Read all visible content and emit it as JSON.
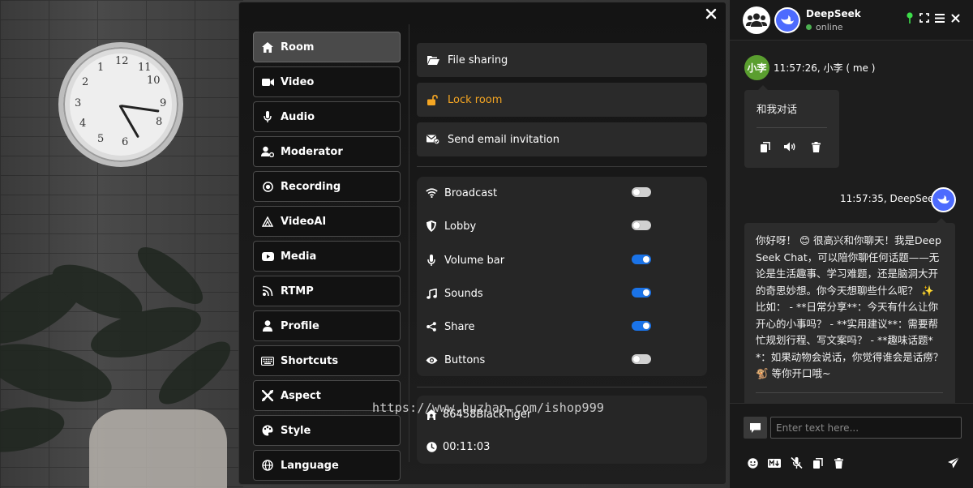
{
  "settings": {
    "tabs": [
      {
        "label": "Room",
        "icon": "home-icon"
      },
      {
        "label": "Video",
        "icon": "video-camera-icon"
      },
      {
        "label": "Audio",
        "icon": "microphone-icon"
      },
      {
        "label": "Moderator",
        "icon": "user-gear-icon"
      },
      {
        "label": "Recording",
        "icon": "record-icon"
      },
      {
        "label": "VideoAI",
        "icon": "ai-triangle-icon"
      },
      {
        "label": "Media",
        "icon": "youtube-icon"
      },
      {
        "label": "RTMP",
        "icon": "broadcast-tower-icon"
      },
      {
        "label": "Profile",
        "icon": "user-icon"
      },
      {
        "label": "Shortcuts",
        "icon": "keyboard-icon"
      },
      {
        "label": "Aspect",
        "icon": "tools-icon"
      },
      {
        "label": "Style",
        "icon": "palette-icon"
      },
      {
        "label": "Language",
        "icon": "globe-icon"
      }
    ],
    "active_tab": "Room",
    "actions": {
      "file_sharing": "File sharing",
      "lock_room": "Lock room",
      "send_email": "Send email invitation"
    },
    "toggles": [
      {
        "label": "Broadcast",
        "on": false,
        "icon": "wifi-icon"
      },
      {
        "label": "Lobby",
        "on": false,
        "icon": "shield-icon"
      },
      {
        "label": "Volume bar",
        "on": true,
        "icon": "microphone-icon"
      },
      {
        "label": "Sounds",
        "on": true,
        "icon": "music-note-icon"
      },
      {
        "label": "Share",
        "on": true,
        "icon": "share-icon"
      },
      {
        "label": "Buttons",
        "on": false,
        "icon": "eye-icon"
      }
    ],
    "info": {
      "room_name": "86458BlackTiger",
      "duration": "00:11:03"
    },
    "accent_color": "#1a73e8",
    "lock_color": "#f5a623"
  },
  "watermark": "https://www.huzhan.com/ishop999",
  "chat": {
    "title": "DeepSeek",
    "status": "online",
    "user_avatar_text": "小李",
    "messages": [
      {
        "meta": "11:57:26, 小李 ( me )",
        "text": "和我对话"
      },
      {
        "meta": "11:57:35, DeepSeek",
        "text": "你好呀！ 😊 很高兴和你聊天！我是DeepSeek Chat，可以陪你聊任何话题——无论是生活趣事、学习难题，还是脑洞大开的奇思妙想。你今天想聊些什么呢？ ✨ 比如： - **日常分享**：今天有什么让你开心的小事吗？ - **实用建议**：需要帮忙规划行程、写文案吗？ - **趣味话题**：如果动物会说话，你觉得谁会是话痨？ 🐒 等你开口哦~"
      }
    ],
    "input_placeholder": "Enter text here..."
  }
}
